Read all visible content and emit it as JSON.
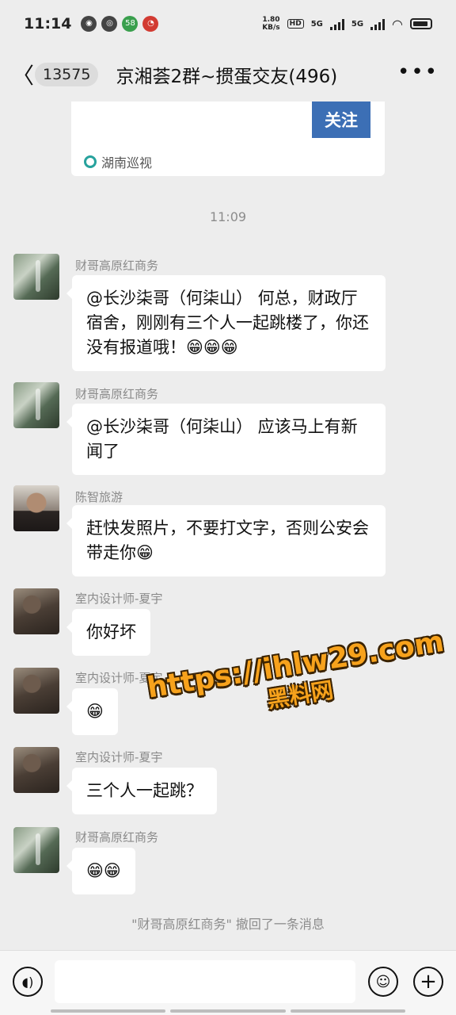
{
  "status_bar": {
    "time": "11:14",
    "speed_value": "1.80",
    "speed_unit": "KB/s",
    "hd": "HD",
    "net1": "5G",
    "net2": "5G"
  },
  "nav": {
    "back_count": "13575",
    "title": "京湘荟2群~掼蛋交友(496)",
    "more_icon": "ellipsis-icon"
  },
  "card": {
    "follow_label": "关注",
    "source": "湖南巡视"
  },
  "timestamp": "11:09",
  "messages": [
    {
      "sender": "财哥高原红商务",
      "text": "@长沙柒哥（何柒山） 何总，财政厅宿舍，刚刚有三个人一起跳楼了，你还没有报道哦！😁😁😁"
    },
    {
      "sender": "财哥高原红商务",
      "text": "@长沙柒哥（何柒山） 应该马上有新闻了"
    },
    {
      "sender": "陈智旅游",
      "text": "赶快发照片，不要打文字，否则公安会带走你😁"
    },
    {
      "sender": "室内设计师-夏宇",
      "text": "你好坏"
    },
    {
      "sender": "室内设计师-夏宇",
      "text": "😁"
    },
    {
      "sender": "室内设计师-夏宇",
      "text": "三个人一起跳？"
    },
    {
      "sender": "财哥高原红商务",
      "text": "😁😁"
    }
  ],
  "recall_notice": "\"财哥高原红商务\" 撤回了一条消息",
  "watermark": {
    "line1": "https://ihlw29.com",
    "line2": "黑料网"
  },
  "input_bar": {
    "voice_icon": "voice-icon",
    "emoji_icon": "emoji-icon",
    "plus_icon": "plus-icon"
  }
}
